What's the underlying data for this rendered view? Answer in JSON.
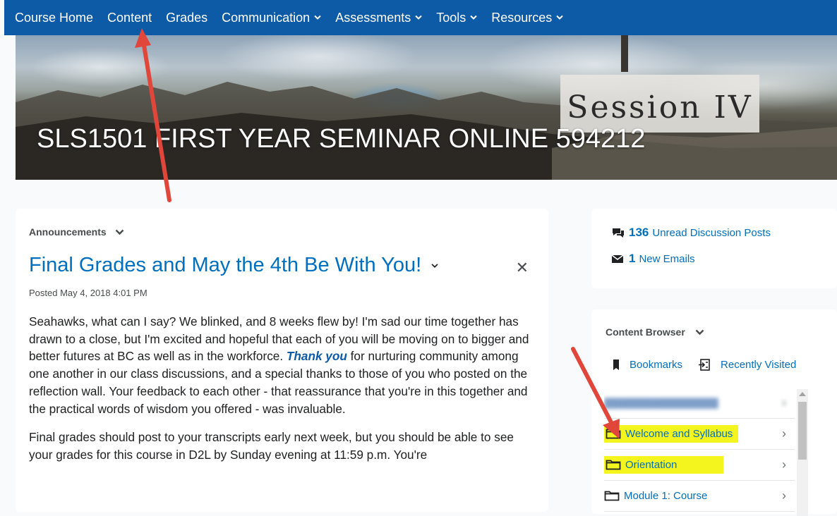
{
  "nav": {
    "items": [
      {
        "label": "Course Home",
        "dropdown": false
      },
      {
        "label": "Content",
        "dropdown": false
      },
      {
        "label": "Grades",
        "dropdown": false
      },
      {
        "label": "Communication",
        "dropdown": true
      },
      {
        "label": "Assessments",
        "dropdown": true
      },
      {
        "label": "Tools",
        "dropdown": true
      },
      {
        "label": "Resources",
        "dropdown": true
      }
    ]
  },
  "banner": {
    "session_label": "Session IV",
    "course_title": "SLS1501 FIRST YEAR SEMINAR ONLINE 594212"
  },
  "announcements": {
    "header": "Announcements",
    "title": "Final Grades and May the 4th Be With You!",
    "posted": "Posted May 4, 2018 4:01 PM",
    "body_p1_before": "Seahawks, what can I say? We blinked, and 8 weeks flew by! I'm sad our time together has drawn to a close, but I'm excited and hopeful that each of you will be moving on to bigger and better futures at BC as well as in the workforce.",
    "body_p1_emph": "Thank you",
    "body_p1_after": "for nurturing community among one another in our class discussions, and a special thanks to those of you who posted on the reflection wall. Your feedback to each other - that reassurance that you're in this together and the practical words of wisdom you offered - was invaluable.",
    "body_p2": "Final grades should post to your transcripts early next week, but you should be able to see your grades for this course in D2L by Sunday evening at 11:59 p.m. You're"
  },
  "stats": {
    "discussion_count": "136",
    "discussion_label": "Unread Discussion Posts",
    "email_count": "1",
    "email_label": "New Emails"
  },
  "content_browser": {
    "header": "Content Browser",
    "bookmarks": "Bookmarks",
    "recently_visited": "Recently Visited",
    "items": [
      {
        "label": "Welcome and Syllabus",
        "highlighted": true
      },
      {
        "label": "Orientation",
        "highlighted": true
      },
      {
        "label": "Module 1: Course",
        "highlighted": false
      }
    ]
  },
  "colors": {
    "nav_bg": "#0d5aa7",
    "link": "#006fbf",
    "highlight": "#f4f41e",
    "annotation_arrow": "#e0463a"
  }
}
